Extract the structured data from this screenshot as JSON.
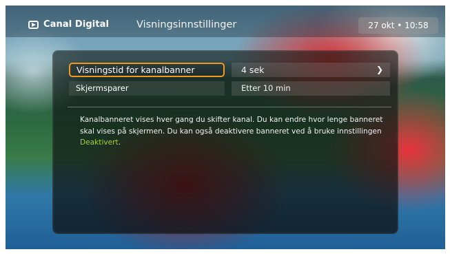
{
  "header": {
    "brand": "Canal Digital",
    "title": "Visningsinnstillinger",
    "datetime": "27 okt • 10:58"
  },
  "settings": [
    {
      "label": "Visningstid for kanalbanner",
      "value": "4 sek",
      "focused": true,
      "icon": "chevron-right-icon"
    },
    {
      "label": "Skjermsparer",
      "value": "Etter 10 min",
      "focused": false
    }
  ],
  "description": {
    "text": "Kanalbanneret vises hver gang du skifter kanal. Du kan endre hvor lenge banneret skal vises på skjermen. Du kan også deaktivere banneret ved å bruke innstillingen ",
    "highlight": "Deaktivert",
    "suffix": "."
  },
  "colors": {
    "focus": "#f29a1f",
    "highlight": "#a6cf3a"
  }
}
